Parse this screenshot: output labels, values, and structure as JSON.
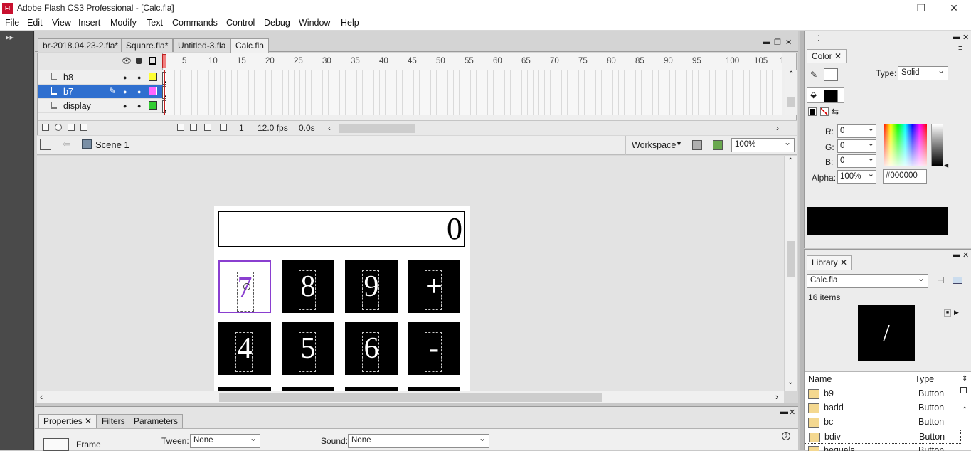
{
  "window": {
    "title": "Adobe Flash CS3 Professional - [Calc.fla]",
    "app_icon_text": "Fl",
    "controls": [
      "—",
      "❐",
      "✕"
    ]
  },
  "menu": [
    "File",
    "Edit",
    "View",
    "Insert",
    "Modify",
    "Text",
    "Commands",
    "Control",
    "Debug",
    "Window",
    "Help"
  ],
  "doc_tabs": [
    {
      "label": "br-2018.04.23-2.fla*",
      "active": false
    },
    {
      "label": "Square.fla*",
      "active": false
    },
    {
      "label": "Untitled-3.fla",
      "active": false
    },
    {
      "label": "Calc.fla",
      "active": true
    }
  ],
  "timeline": {
    "ruler": [
      "5",
      "10",
      "15",
      "20",
      "25",
      "30",
      "35",
      "40",
      "45",
      "50",
      "55",
      "60",
      "65",
      "70",
      "75",
      "80",
      "85",
      "90",
      "95",
      "100",
      "105",
      "1"
    ],
    "layers": [
      {
        "name": "b8",
        "color": "#ffff33",
        "selected": false
      },
      {
        "name": "b7",
        "color": "#ff66ff",
        "selected": true
      },
      {
        "name": "display",
        "color": "#33cc33",
        "selected": false
      }
    ],
    "status": {
      "frame": "1",
      "fps": "12.0 fps",
      "time": "0.0s"
    }
  },
  "editbar": {
    "scene": "Scene 1",
    "workspace": "Workspace",
    "zoom": "100%"
  },
  "stage": {
    "display_value": "0",
    "keys": [
      {
        "label": "7",
        "selected": true
      },
      {
        "label": "8",
        "selected": false
      },
      {
        "label": "9",
        "selected": false
      },
      {
        "label": "+",
        "selected": false
      },
      {
        "label": "4",
        "selected": false
      },
      {
        "label": "5",
        "selected": false
      },
      {
        "label": "6",
        "selected": false
      },
      {
        "label": "-",
        "selected": false
      }
    ]
  },
  "properties": {
    "tabs": [
      "Properties",
      "Filters",
      "Parameters"
    ],
    "frame_label": "Frame",
    "tween_label": "Tween:",
    "tween_value": "None",
    "sound_label": "Sound:",
    "sound_value": "None"
  },
  "color_panel": {
    "title": "Color",
    "type_label": "Type:",
    "type_value": "Solid",
    "r_label": "R:",
    "r_value": "0",
    "g_label": "G:",
    "g_value": "0",
    "b_label": "B:",
    "b_value": "0",
    "alpha_label": "Alpha:",
    "alpha_value": "100%",
    "hex_value": "#000000"
  },
  "library_panel": {
    "title": "Library",
    "document": "Calc.fla",
    "item_count": "16 items",
    "preview_symbol": "/",
    "col_name": "Name",
    "col_type": "Type",
    "items": [
      {
        "name": "b9",
        "type": "Button"
      },
      {
        "name": "badd",
        "type": "Button"
      },
      {
        "name": "bc",
        "type": "Button"
      },
      {
        "name": "bdiv",
        "type": "Button"
      },
      {
        "name": "bequals",
        "type": "Button"
      }
    ]
  }
}
